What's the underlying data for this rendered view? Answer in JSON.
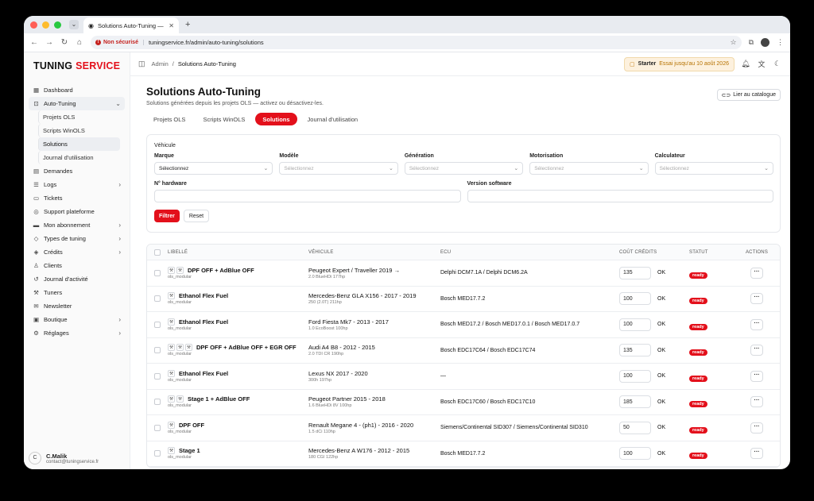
{
  "browser": {
    "tab_title": "Solutions Auto-Tuning — Adm",
    "security": "Non sécurisé",
    "url": "tuningservice.fr/admin/auto-tuning/solutions"
  },
  "brand": {
    "part1": "TUNING",
    "part2": "SERVICE"
  },
  "sidebar": {
    "items": [
      {
        "label": "Dashboard",
        "icon": "dashboard-icon"
      },
      {
        "label": "Auto-Tuning",
        "icon": "auto-tuning-icon"
      },
      {
        "label": "Demandes",
        "icon": "demandes-icon"
      },
      {
        "label": "Logs",
        "icon": "logs-icon"
      },
      {
        "label": "Tickets",
        "icon": "tickets-icon"
      },
      {
        "label": "Support plateforme",
        "icon": "support-icon"
      },
      {
        "label": "Mon abonnement",
        "icon": "abonnement-icon"
      },
      {
        "label": "Types de tuning",
        "icon": "tag-icon"
      },
      {
        "label": "Crédits",
        "icon": "credits-icon"
      },
      {
        "label": "Clients",
        "icon": "clients-icon"
      },
      {
        "label": "Journal d'activité",
        "icon": "history-icon"
      },
      {
        "label": "Tuners",
        "icon": "wrench-icon"
      },
      {
        "label": "Newsletter",
        "icon": "mail-icon"
      },
      {
        "label": "Boutique",
        "icon": "shop-icon"
      },
      {
        "label": "Réglages",
        "icon": "settings-icon"
      }
    ],
    "sub_items": [
      "Projets OLS",
      "Scripts WinOLS",
      "Solutions",
      "Journal d'utilisation"
    ]
  },
  "user": {
    "initial": "C",
    "name": "C.Malik",
    "email": "contact@tuningservice.fr"
  },
  "topbar": {
    "crumb_root": "Admin",
    "crumb_sep": "/",
    "crumb_current": "Solutions Auto-Tuning",
    "plan_name": "Starter",
    "plan_note": "Essai jusqu'au 10 août 2026"
  },
  "page": {
    "title": "Solutions Auto-Tuning",
    "subtitle": "Solutions générées depuis les projets OLS — activez ou désactivez-les.",
    "link_button": "Lier au catalogue",
    "tabs": [
      "Projets OLS",
      "Scripts WinOLS",
      "Solutions",
      "Journal d'utilisation"
    ]
  },
  "filters": {
    "section": "Véhicule",
    "marque": {
      "label": "Marque",
      "value": "Sélectionnez"
    },
    "modele": {
      "label": "Modèle",
      "value": "Sélectionnez"
    },
    "generation": {
      "label": "Génération",
      "value": "Sélectionnez"
    },
    "motorisation": {
      "label": "Motorisation",
      "value": "Sélectionnez"
    },
    "calculateur": {
      "label": "Calculateur",
      "value": "Sélectionnez"
    },
    "hardware_label": "N° hardware",
    "software_label": "Version software",
    "filter_button": "Filtrer",
    "reset_button": "Reset"
  },
  "table": {
    "headers": [
      "Libellé",
      "Véhicule",
      "ECU",
      "Coût crédits",
      "Statut",
      "Actions"
    ],
    "rows": [
      {
        "icons": 2,
        "label": "DPF OFF + AdBlue OFF",
        "sub": "ols_modular",
        "vehicle": "Peugeot Expert / Traveller 2019 →",
        "vehicle_sub": "2.0 BlueHDi 177hp",
        "ecu": "Delphi DCM7.1A / Delphi DCM6.2A",
        "credits": "135",
        "ok": "OK",
        "status": "ready"
      },
      {
        "icons": 1,
        "label": "Ethanol Flex Fuel",
        "sub": "ols_modular",
        "vehicle": "Mercedes-Benz GLA X156 - 2017 - 2019",
        "vehicle_sub": "250 (2.0T) 211hp",
        "ecu": "Bosch MED17.7.2",
        "credits": "100",
        "ok": "OK",
        "status": "ready"
      },
      {
        "icons": 1,
        "label": "Ethanol Flex Fuel",
        "sub": "ols_modular",
        "vehicle": "Ford Fiesta Mk7 - 2013 - 2017",
        "vehicle_sub": "1.0 EcoBoost 100hp",
        "ecu": "Bosch MED17.2 / Bosch MED17.0.1 / Bosch MED17.0.7",
        "credits": "100",
        "ok": "OK",
        "status": "ready"
      },
      {
        "icons": 3,
        "label": "DPF OFF + AdBlue OFF + EGR OFF",
        "sub": "ols_modular",
        "vehicle": "Audi A4 B8 - 2012 - 2015",
        "vehicle_sub": "2.0 TDI CR 190hp",
        "ecu": "Bosch EDC17C64 / Bosch EDC17C74",
        "credits": "135",
        "ok": "OK",
        "status": "ready"
      },
      {
        "icons": 1,
        "label": "Ethanol Flex Fuel",
        "sub": "ols_modular",
        "vehicle": "Lexus NX 2017 - 2020",
        "vehicle_sub": "300h 197hp",
        "ecu": "—",
        "credits": "100",
        "ok": "OK",
        "status": "ready"
      },
      {
        "icons": 2,
        "label": "Stage 1 + AdBlue OFF",
        "sub": "ols_modular",
        "vehicle": "Peugeot Partner 2015 - 2018",
        "vehicle_sub": "1.6 BlueHDi 8V 100hp",
        "ecu": "Bosch EDC17C60 / Bosch EDC17C10",
        "credits": "185",
        "ok": "OK",
        "status": "ready"
      },
      {
        "icons": 1,
        "label": "DPF OFF",
        "sub": "ols_modular",
        "vehicle": "Renault Megane 4 - (ph1) - 2016 - 2020",
        "vehicle_sub": "1.5 dCi 110hp",
        "ecu": "Siemens/Continental SID307 / Siemens/Continental SID310",
        "credits": "50",
        "ok": "OK",
        "status": "ready"
      },
      {
        "icons": 1,
        "label": "Stage 1",
        "sub": "ols_modular",
        "vehicle": "Mercedes-Benz A W176 - 2012 - 2015",
        "vehicle_sub": "180 CGI 122hp",
        "ecu": "Bosch MED17.7.2",
        "credits": "100",
        "ok": "OK",
        "status": "ready"
      }
    ]
  },
  "colors": {
    "accent": "#e3101b",
    "plan_bg": "#fdf1de"
  }
}
